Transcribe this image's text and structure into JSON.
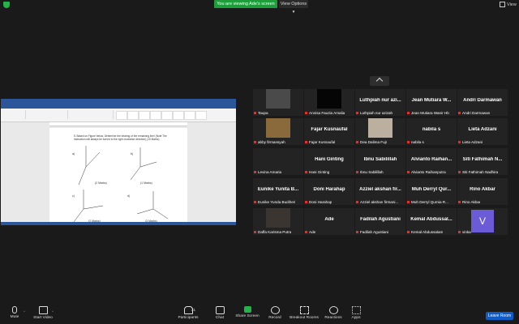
{
  "topbar": {
    "viewing_label": "You are viewing Ade's screen",
    "view_options_label": "View Options ▾",
    "view_label": "View"
  },
  "document": {
    "question": "5.   Based on Figure below, Determine the bearing of the remaining line! (Note The instruction will always be turned to the right clockwise direction) (10 Marks)",
    "mark_a": "(2 Marks)",
    "mark_b": "(1 Marks)",
    "mark_c": "(2 Marks)",
    "mark_d": "(3 Marks)",
    "label_a": "a)",
    "label_b": "b)",
    "label_c": "c)",
    "label_d": "d)"
  },
  "gallery": [
    {
      "big": "",
      "label": "Taupa"
    },
    {
      "big": "",
      "label": "Annisa Fauzia Amalia"
    },
    {
      "big": "Luthpiah nur azi...",
      "label": "Luthpiah nur azizah"
    },
    {
      "big": "Jean Mutiara W...",
      "label": "Jean Mutiara Wanir Hb"
    },
    {
      "big": "Andri Darmawan",
      "label": "Andri Darmawan"
    },
    {
      "big": "",
      "label": "abby firmansyah"
    },
    {
      "big": "Fajar Kusnaufal",
      "label": "Fajar Kusnaufal"
    },
    {
      "big": "",
      "label": "Dea Dalima Fujr"
    },
    {
      "big": "nabila s",
      "label": "nabila s"
    },
    {
      "big": "Lieta Adzani",
      "label": "Lieta Adzani"
    },
    {
      "big": "",
      "label": "Levina Amaria"
    },
    {
      "big": "Hani Ginting",
      "label": "Hani Ginting"
    },
    {
      "big": "Ibnu Sabilillah",
      "label": "Ibnu Sabilillah"
    },
    {
      "big": "Alvianto Raihan...",
      "label": "Alvianto Raihanputra"
    },
    {
      "big": "Siti Fathimah N...",
      "label": "Siti Fathimah Nadhira"
    },
    {
      "big": "Eunike Yunita B...",
      "label": "Eunike Yunda Budiheri"
    },
    {
      "big": "Doni Harahap",
      "label": "Doni Harahap"
    },
    {
      "big": "Azziel akshan fir...",
      "label": "Azziel akshan firmani..."
    },
    {
      "big": "Muh Derryl Qur...",
      "label": "Muh Derryl Qurnia R..."
    },
    {
      "big": "Rino Akbar",
      "label": "Rino Akbar"
    },
    {
      "big": "",
      "label": "Daffa Karisma Putra"
    },
    {
      "big": "Ade",
      "label": "Ade"
    },
    {
      "big": "Fadilah Agustiani",
      "label": "Fadilah Agustiani"
    },
    {
      "big": "Kemal Abdussal...",
      "label": "Kemal Abdussalam"
    },
    {
      "big": "",
      "label": "vinka",
      "avatar": "V"
    }
  ],
  "toolbar": {
    "mute": "Mute",
    "start_video": "Start Video",
    "participants": "Participants",
    "participants_count": "31",
    "chat": "Chat",
    "share_screen": "Share Screen",
    "record": "Record",
    "breakout": "Breakout Rooms",
    "reactions": "Reactions",
    "apps": "Apps",
    "leave": "Leave Room"
  },
  "colors": {
    "accent_green": "#23b34a",
    "leave_blue": "#0e5cc9",
    "word_blue": "#2b579a",
    "avatar_purple": "#6b5bd6"
  }
}
